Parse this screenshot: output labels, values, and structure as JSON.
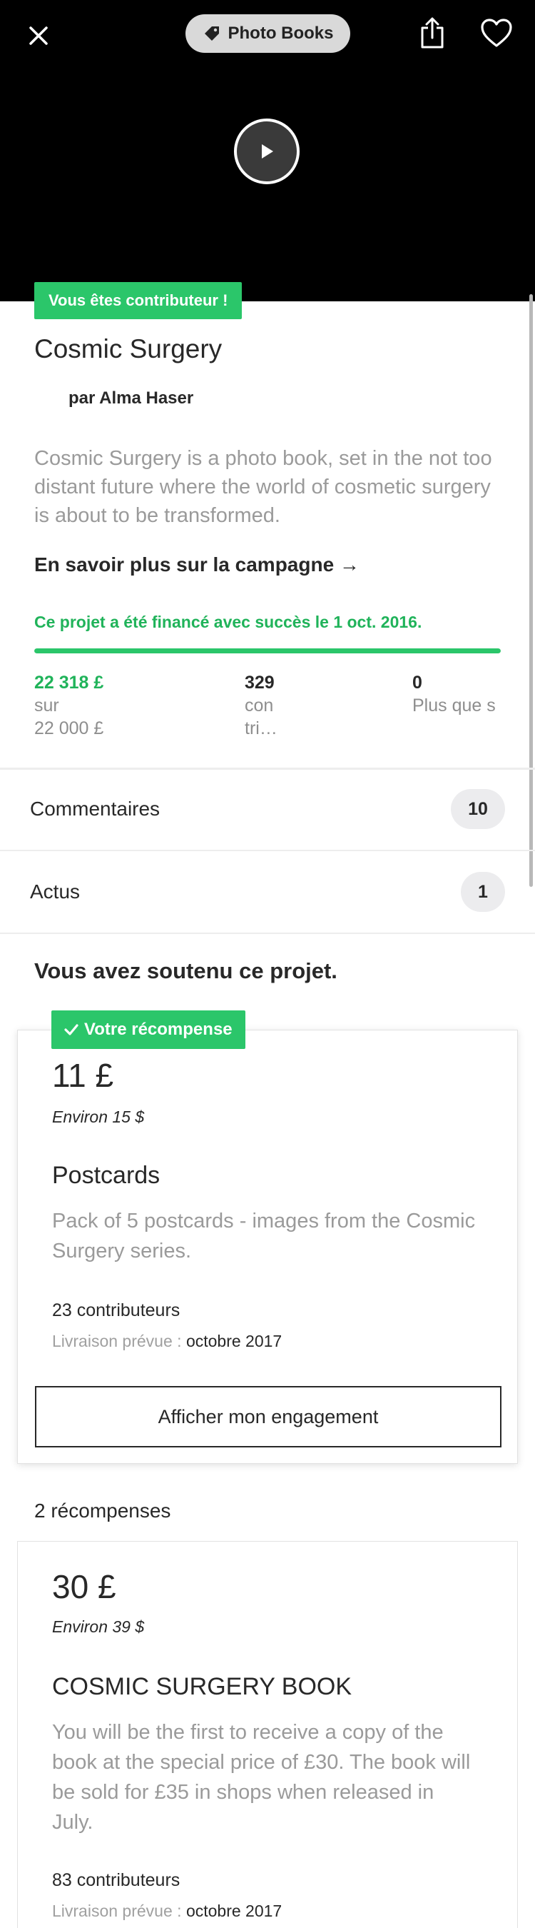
{
  "header": {
    "category": "Photo Books"
  },
  "project": {
    "backer_badge": "Vous êtes contributeur !",
    "title": "Cosmic Surgery",
    "byline": "par Alma Haser",
    "blurb": "Cosmic Surgery is a photo book, set in the not too distant future where the world of cosmetic surgery is about to be transformed.",
    "learn_more": "En savoir plus sur la campagne →",
    "funded_message": "Ce projet a été financé avec succès le 1 oct. 2016.",
    "progress_percent": 100,
    "stats": {
      "pledged": "22 318 £",
      "pledged_sub1": "sur",
      "pledged_sub2": "22 000 £",
      "backers": "329",
      "backers_sub1": "con",
      "backers_sub2": "tri…",
      "days": "0",
      "days_sub": "Plus que s"
    }
  },
  "sections": {
    "comments_label": "Commentaires",
    "comments_count": "10",
    "updates_label": "Actus",
    "updates_count": "1"
  },
  "backing": {
    "heading": "Vous avez soutenu ce projet.",
    "badge": "Votre récompense",
    "amount": "11 £",
    "approx": "Environ 15 $",
    "title": "Postcards",
    "description": "Pack of 5 postcards - images from the Cosmic Surgery series.",
    "backers": "23 contributeurs",
    "delivery_label": "Livraison prévue :",
    "delivery_date": "octobre 2017",
    "manage_button": "Afficher mon engagement"
  },
  "rewards": {
    "count_label": "2 récompenses",
    "items": [
      {
        "amount": "30 £",
        "approx": "Environ 39 $",
        "title": "COSMIC SURGERY BOOK",
        "description": "You will be the first to receive a copy of the book at the special price of £30. The book will be sold for £35 in shops when released in July.",
        "backers": "83 contributeurs",
        "delivery_label": "Livraison prévue :",
        "delivery_date": "octobre 2017"
      }
    ]
  },
  "colors": {
    "accent_green": "#2bc66a",
    "funded_text_green": "#20b35a"
  }
}
